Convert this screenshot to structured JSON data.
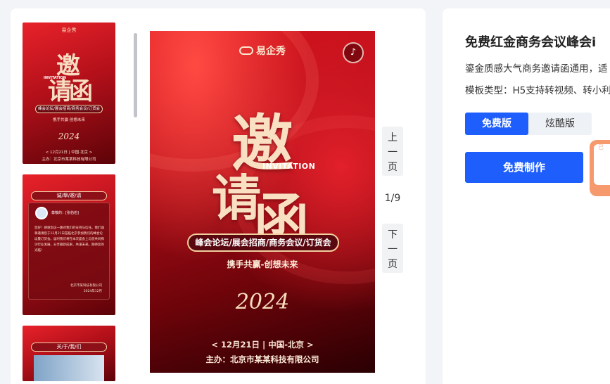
{
  "thumbnails": [
    {
      "logo": "易企秀",
      "big1": "邀",
      "big2": "请函",
      "invitation": "INVITATION",
      "tags": "峰会论坛/展会招商/商务会议/订货会",
      "slogan": "携手共赢·创想未来",
      "year": "2024",
      "date": "< 12月21日 | 中国·北京 >",
      "host": "主办：北京市某某科技有限公司"
    },
    {
      "banner": "诚/挚/邀/请",
      "name": "尊敬的：[张伯伯]",
      "body": "您好！感谢您这一路对我们的支持与信任。我们诚挚邀请您于12月21日莅临北京参加我们的峰会论坛暨订货会。届时我们将在本次盛会上与您共同探讨行业发展，分享最新成果，共谋未来。期待您的光临！",
      "sign_company": "北京市某科技有限公司",
      "sign_date": "2024年12月"
    },
    {
      "banner": "关/于/我/们"
    }
  ],
  "poster": {
    "logo": "易企秀",
    "music_icon": "music-icon",
    "big1": "邀",
    "big2": "请",
    "big3": "函",
    "invitation": "INVITATION",
    "tags": "峰会论坛/展会招商/商务会议/订货会",
    "slogan": "携手共赢-创想未来",
    "year": "2024",
    "date": "< 12月21日 | 中国-北京 >",
    "host": "主办：北京市某某科技有限公司"
  },
  "pager": {
    "prev": "上一页",
    "next": "下一页",
    "indicator": "1/9"
  },
  "details": {
    "title": "免费红金商务会议峰会i",
    "desc": "鎏金质感大气商务邀请函通用，适",
    "type": "模板类型：H5支持转视频、转小利",
    "tabs": [
      "免费版",
      "炫酷版"
    ],
    "make_button": "免费制作",
    "side_tag": "已"
  },
  "colors": {
    "primary": "#1e5efc",
    "poster_red": "#b10d18",
    "gold": "#fae0c3"
  }
}
